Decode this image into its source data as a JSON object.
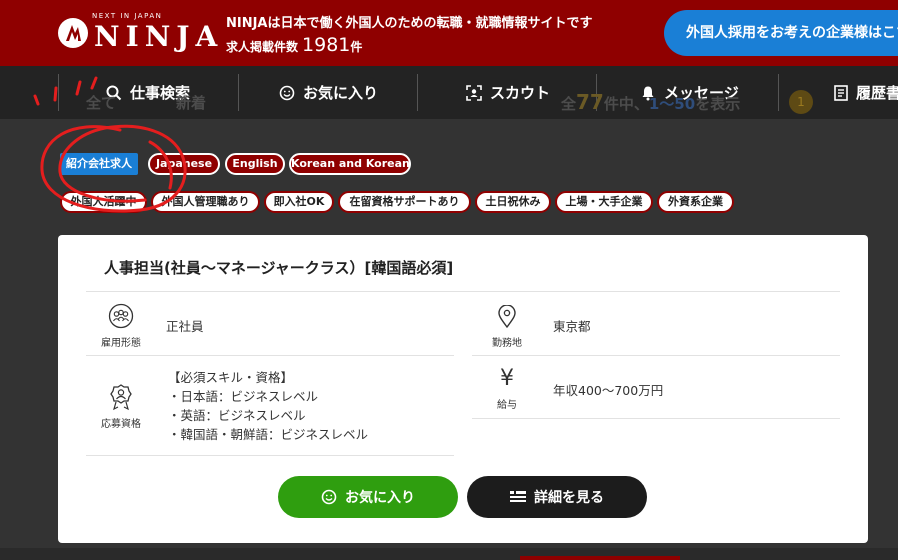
{
  "header": {
    "logo_tagline": "NEXT IN JAPAN",
    "logo_text": "NINJA",
    "tagline": "NINJAは日本で働く外国人のための転職・就職情報サイトです",
    "count_label": "求人掲載件数",
    "count_value": "1981",
    "count_unit": "件",
    "employer_button": "外国人採用をお考えの企業様はこちら",
    "brand_color": "#8f0000",
    "accent_color": "#1a7fd6"
  },
  "nav": {
    "items": [
      {
        "label": "仕事検索",
        "icon": "search-icon"
      },
      {
        "label": "お気に入り",
        "icon": "smile-icon"
      },
      {
        "label": "スカウト",
        "icon": "scout-icon"
      },
      {
        "label": "メッセージ",
        "icon": "bell-icon"
      },
      {
        "label": "履歴書",
        "icon": "document-icon"
      }
    ]
  },
  "behind": {
    "left_text": "全て",
    "left_text2": "新着",
    "result_prefix": "全",
    "result_total": "77",
    "result_mid": "件中、",
    "result_range": "1〜50",
    "result_suffix": "を表示",
    "page_number": "1"
  },
  "job": {
    "agent_badge": "紹介会社求人",
    "languages": [
      "Japanese",
      "English",
      "Korean and Korean"
    ],
    "features": [
      "外国人活躍中",
      "外国人管理職あり",
      "即入社OK",
      "在留資格サポートあり",
      "土日祝休み",
      "上場・大手企業",
      "外資系企業"
    ],
    "title": "人事担当(社員〜マネージャークラス）[韓国語必須]",
    "employment_type_label": "雇用形態",
    "employment_type": "正社員",
    "location_label": "勤務地",
    "location": "東京都",
    "requirements_label": "応募資格",
    "requirements": [
      "【必須スキル・資格】",
      "・日本語：ビジネスレベル",
      "・英語：ビジネスレベル",
      "・韓国語・朝鮮語：ビジネスレベル"
    ],
    "salary_label": "給与",
    "salary_symbol": "¥",
    "salary": "年収400〜700万円",
    "favorite_button": "お気に入り",
    "detail_button": "詳細を見る"
  }
}
